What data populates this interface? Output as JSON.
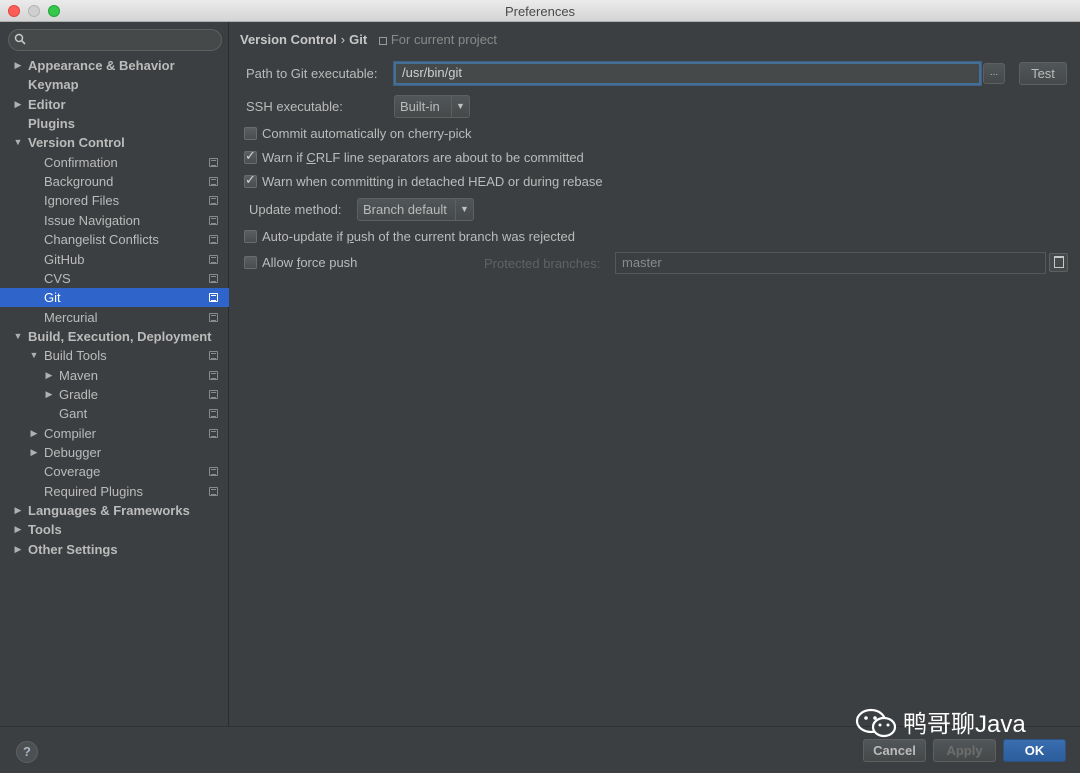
{
  "window": {
    "title": "Preferences"
  },
  "sidebar": {
    "search_placeholder": "",
    "tree": [
      {
        "label": "Appearance & Behavior",
        "level": 0,
        "arrow": "right",
        "bold": true
      },
      {
        "label": "Keymap",
        "level": 0,
        "arrow": "",
        "bold": true
      },
      {
        "label": "Editor",
        "level": 0,
        "arrow": "right",
        "bold": true
      },
      {
        "label": "Plugins",
        "level": 0,
        "arrow": "",
        "bold": true
      },
      {
        "label": "Version Control",
        "level": 0,
        "arrow": "down",
        "bold": true
      },
      {
        "label": "Confirmation",
        "level": 1,
        "arrow": "",
        "project": true
      },
      {
        "label": "Background",
        "level": 1,
        "arrow": "",
        "project": true
      },
      {
        "label": "Ignored Files",
        "level": 1,
        "arrow": "",
        "project": true
      },
      {
        "label": "Issue Navigation",
        "level": 1,
        "arrow": "",
        "project": true
      },
      {
        "label": "Changelist Conflicts",
        "level": 1,
        "arrow": "",
        "project": true
      },
      {
        "label": "GitHub",
        "level": 1,
        "arrow": "",
        "project": true
      },
      {
        "label": "CVS",
        "level": 1,
        "arrow": "",
        "project": true
      },
      {
        "label": "Git",
        "level": 1,
        "arrow": "",
        "project": true,
        "selected": true
      },
      {
        "label": "Mercurial",
        "level": 1,
        "arrow": "",
        "project": true
      },
      {
        "label": "Build, Execution, Deployment",
        "level": 0,
        "arrow": "down",
        "bold": true
      },
      {
        "label": "Build Tools",
        "level": 1,
        "arrow": "down",
        "project": true
      },
      {
        "label": "Maven",
        "level": 2,
        "arrow": "right",
        "project": true
      },
      {
        "label": "Gradle",
        "level": 2,
        "arrow": "right",
        "project": true
      },
      {
        "label": "Gant",
        "level": 2,
        "arrow": "",
        "project": true
      },
      {
        "label": "Compiler",
        "level": 1,
        "arrow": "right",
        "project": true
      },
      {
        "label": "Debugger",
        "level": 1,
        "arrow": "right"
      },
      {
        "label": "Coverage",
        "level": 1,
        "arrow": "",
        "project": true
      },
      {
        "label": "Required Plugins",
        "level": 1,
        "arrow": "",
        "project": true
      },
      {
        "label": "Languages & Frameworks",
        "level": 0,
        "arrow": "right",
        "bold": true
      },
      {
        "label": "Tools",
        "level": 0,
        "arrow": "right",
        "bold": true
      },
      {
        "label": "Other Settings",
        "level": 0,
        "arrow": "right",
        "bold": true
      }
    ]
  },
  "breadcrumb": {
    "part1": "Version Control",
    "separator": "›",
    "part2": "Git",
    "scope": "For current project"
  },
  "git": {
    "path_label": "Path to Git executable:",
    "path_value": "/usr/bin/git",
    "browse_label": "...",
    "test_label": "Test",
    "ssh_label": "SSH executable:",
    "ssh_value": "Built-in",
    "cherry_pick_label": "Commit automatically on cherry-pick",
    "cherry_pick_checked": false,
    "crlf_label_pre": "Warn if ",
    "crlf_label_u": "C",
    "crlf_label_post": "RLF line separators are about to be committed",
    "crlf_checked": true,
    "detached_label": "Warn when committing in detached HEAD or during rebase",
    "detached_checked": true,
    "update_method_label": "Update method:",
    "update_method_value": "Branch default",
    "auto_update_pre": "Auto-update if ",
    "auto_update_u": "p",
    "auto_update_post": "ush of the current branch was rejected",
    "auto_update_checked": false,
    "force_push_pre": "Allow ",
    "force_push_u": "f",
    "force_push_post": "orce push",
    "force_push_checked": false,
    "protected_label": "Protected branches:",
    "protected_value": "master"
  },
  "footer": {
    "help_label": "?",
    "cancel_label": "Cancel",
    "apply_label": "Apply",
    "ok_label": "OK"
  },
  "watermark": {
    "text": "鸭哥聊Java"
  },
  "colors": {
    "selection": "#2f65ca",
    "background": "#3c3f41",
    "primary_button": "#2c5d9c"
  },
  "icons": {
    "search": "search-icon",
    "project_scope": "project-scope-icon",
    "browse": "browse-icon",
    "protected_branch_edit": "edit-icon",
    "help": "help-icon"
  }
}
